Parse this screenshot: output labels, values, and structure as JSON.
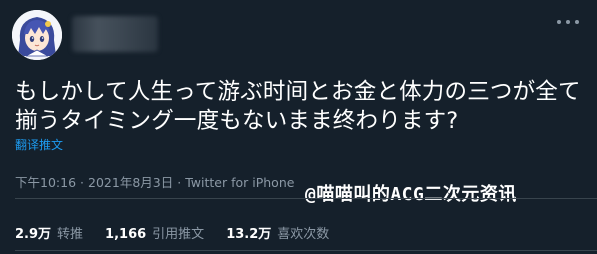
{
  "tweet": {
    "text": "もしかして人生って游ぶ时间とお金と体力の三つが全て揃うタイミング一度もないまま终わります?",
    "translate_label": "翻译推文",
    "time": "下午10:16",
    "separator": "·",
    "date": "2021年8月3日",
    "source": "Twitter for iPhone"
  },
  "stats": {
    "retweets_count": "2.9万",
    "retweets_label": "转推",
    "quotes_count": "1,166",
    "quotes_label": "引用推文",
    "likes_count": "13.2万",
    "likes_label": "喜欢次数"
  },
  "watermark": {
    "text": "@喵喵叫的ACG二次元资讯"
  },
  "icons": {
    "avatar": "anime-character-avatar",
    "more": "more-options-icon"
  },
  "colors": {
    "background": "#15202b",
    "text": "#ffffff",
    "secondary": "#8b98a5",
    "link": "#1d9bf0",
    "divider": "#38444d"
  }
}
